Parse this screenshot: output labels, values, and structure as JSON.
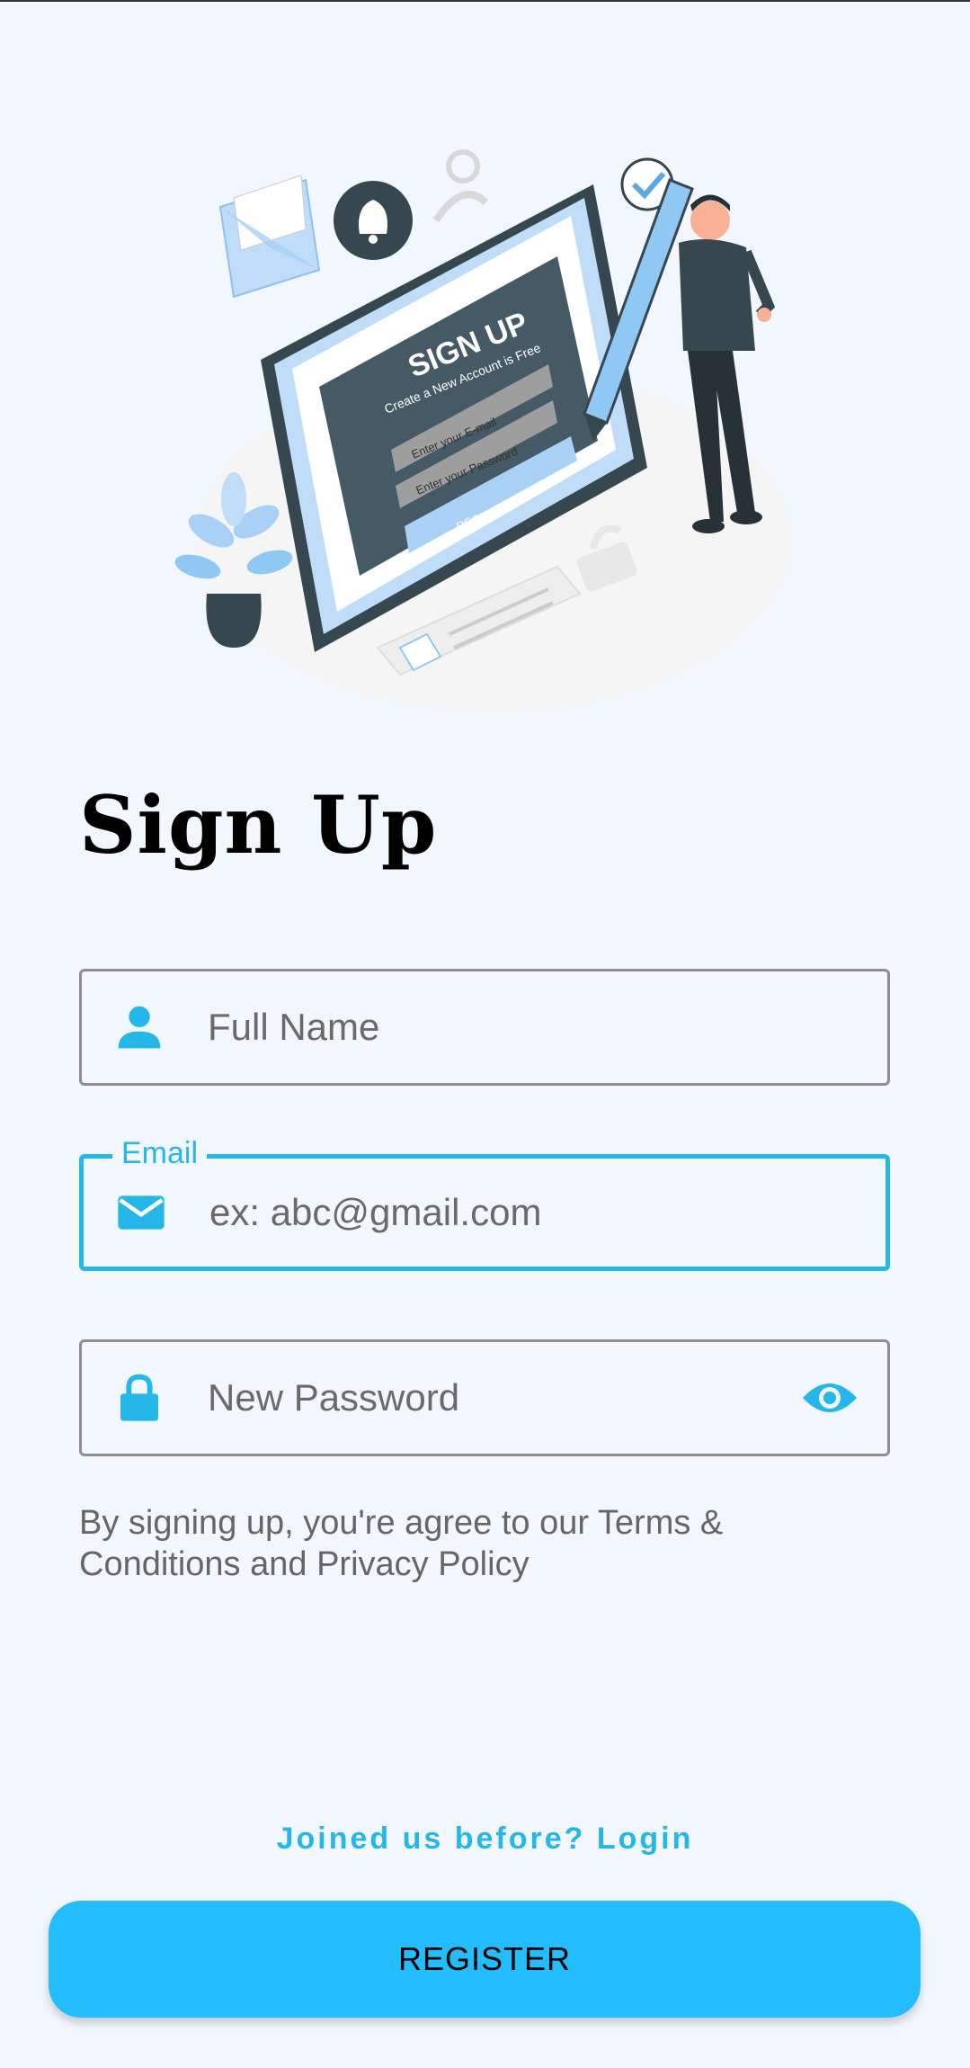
{
  "screen": {
    "title": "Sign Up"
  },
  "illustration": {
    "heading": "SIGN UP",
    "subheading": "Create a New Account is Free",
    "email_placeholder": "Enter your E-mail",
    "password_placeholder": "Enter your Password",
    "button": "REGISTER"
  },
  "form": {
    "full_name": {
      "placeholder": "Full Name",
      "icon": "person-icon"
    },
    "email": {
      "label": "Email",
      "placeholder": "ex: abc@gmail.com",
      "icon": "mail-icon"
    },
    "password": {
      "placeholder": "New Password",
      "icon": "lock-icon",
      "toggle_icon": "eye-icon"
    }
  },
  "terms_text": "By signing up, you're agree to our Terms & Conditions and Privacy Policy",
  "login_link": "Joined us before? Login",
  "register_button": "REGISTER",
  "colors": {
    "accent": "#25B7E8",
    "button": "#22BDFA",
    "background": "#F2F7FD"
  }
}
